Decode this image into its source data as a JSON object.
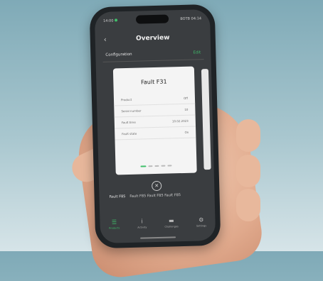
{
  "status": {
    "left": "14:00",
    "right": "BOTB 04:14"
  },
  "header": {
    "back_glyph": "‹",
    "title": "Overview"
  },
  "configuration": {
    "label": "Configuration",
    "action": "Edit"
  },
  "card": {
    "title": "Fault F31",
    "rows": [
      {
        "k": "Product",
        "v": "Off"
      },
      {
        "k": "Serial number",
        "v": "10"
      },
      {
        "k": "Fault time",
        "v": "10.02.2023"
      },
      {
        "k": "Fault state",
        "v": "On"
      }
    ],
    "page_count": 5,
    "active_page": 0
  },
  "fault_line": {
    "label": "Fault F85",
    "text": "Fault F85 Fault F85 Fault F85"
  },
  "tabs": [
    {
      "label": "Products",
      "icon": "list-icon",
      "glyph": "☰",
      "active": true
    },
    {
      "label": "Activity",
      "icon": "info-icon",
      "glyph": "ⅰ",
      "active": false
    },
    {
      "label": "Challenges",
      "icon": "folder-icon",
      "glyph": "▬",
      "active": false
    },
    {
      "label": "Settings",
      "icon": "gear-icon",
      "glyph": "⚙",
      "active": false
    }
  ],
  "colors": {
    "accent": "#3fbf6a",
    "screen": "#3a3d40",
    "card": "#f4f4f4"
  }
}
